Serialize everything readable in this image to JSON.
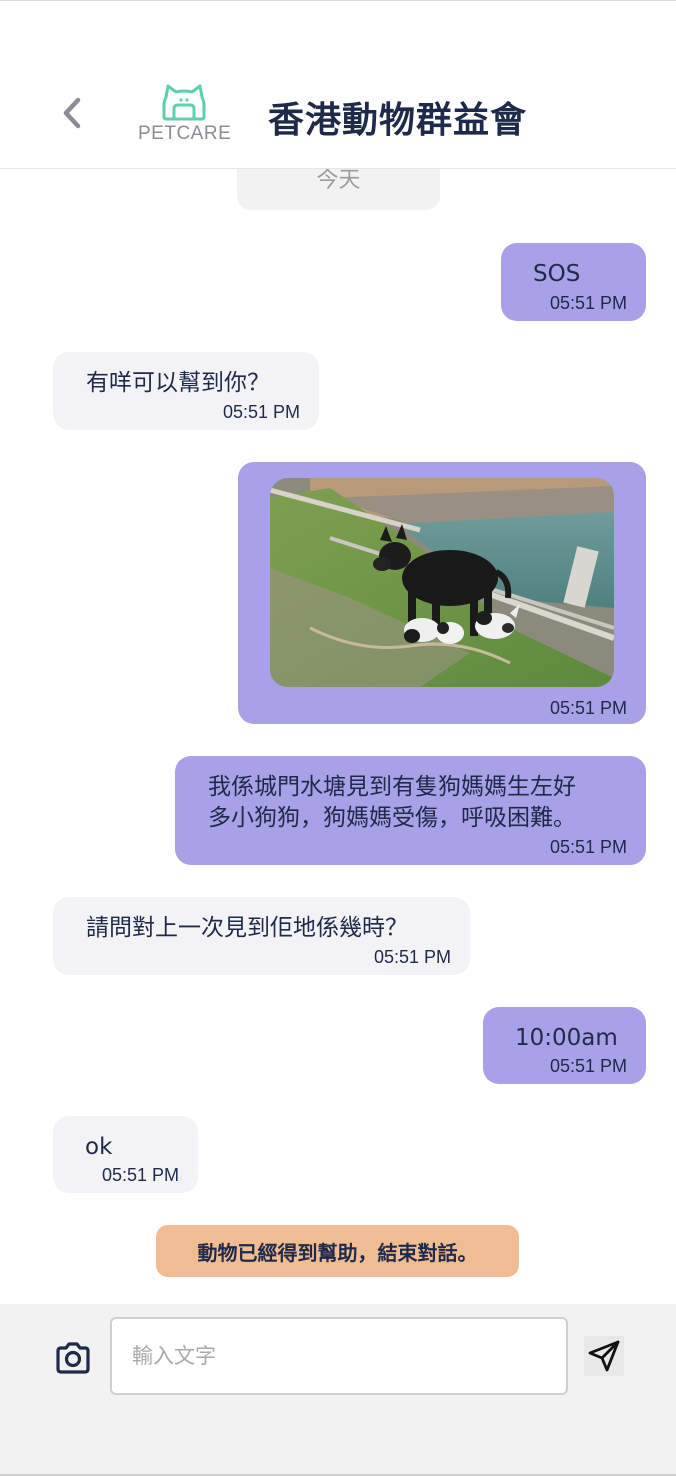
{
  "header": {
    "back_icon": "chevron-left-icon",
    "logo_text": "PETCARE",
    "title": "香港動物群益會"
  },
  "chat": {
    "date_label": "今天",
    "messages": [
      {
        "direction": "out",
        "text": "SOS",
        "time": "05:51 PM"
      },
      {
        "direction": "in",
        "text": "有咩可以幫到你？",
        "time": "05:51 PM"
      },
      {
        "direction": "out",
        "type": "image",
        "image_desc": "dog-with-puppies-photo",
        "time": "05:51 PM"
      },
      {
        "direction": "out",
        "lines": [
          "我係城門水塘見到有隻狗媽媽生左好",
          "多小狗狗，狗媽媽受傷，呼吸困難。"
        ],
        "time": "05:51 PM"
      },
      {
        "direction": "in",
        "text": "請問對上一次見到佢地係幾時？",
        "time": "05:51 PM"
      },
      {
        "direction": "out",
        "text": "10:00am",
        "time": "05:51 PM"
      },
      {
        "direction": "in",
        "text": "ok",
        "time": "05:51 PM"
      }
    ],
    "end_notice": "動物已經得到幫助，結束對話。"
  },
  "input_bar": {
    "camera_icon": "camera-icon",
    "placeholder": "輸入文字",
    "value": "",
    "send_icon": "send-icon"
  },
  "colors": {
    "outgoing_bubble": "#a8a1e8",
    "incoming_bubble": "#f3f3f5",
    "end_notice": "#efbc94",
    "brand_teal": "#5fcfb3",
    "text_dark": "#1f2a4a"
  }
}
